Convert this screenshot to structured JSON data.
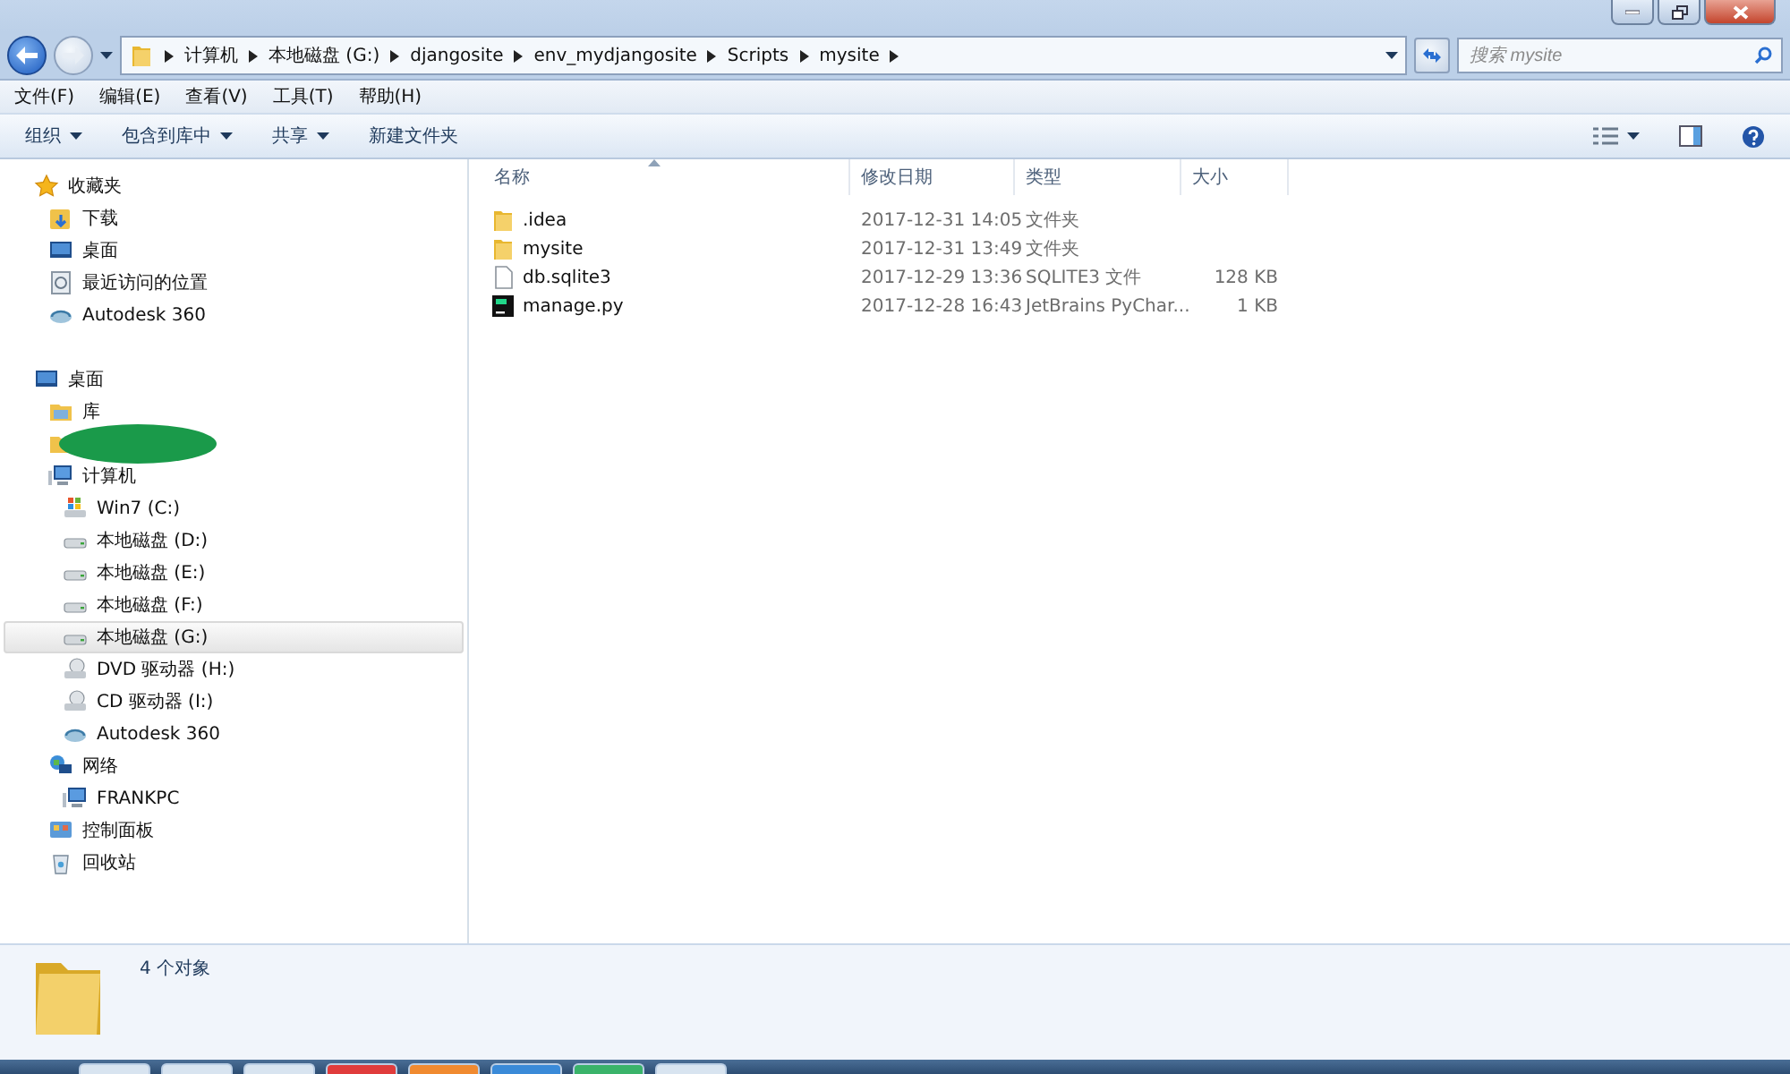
{
  "address": {
    "crumbs": [
      "计算机",
      "本地磁盘 (G:)",
      "djangosite",
      "env_mydjangosite",
      "Scripts",
      "mysite"
    ]
  },
  "search": {
    "placeholder": "搜索 mysite"
  },
  "menu": [
    "文件(F)",
    "编辑(E)",
    "查看(V)",
    "工具(T)",
    "帮助(H)"
  ],
  "toolbar": [
    {
      "label": "组织",
      "dropdown": true
    },
    {
      "label": "包含到库中",
      "dropdown": true
    },
    {
      "label": "共享",
      "dropdown": true
    },
    {
      "label": "新建文件夹",
      "dropdown": false
    }
  ],
  "sidebar": {
    "groups": [
      {
        "label": "收藏夹",
        "kind": "star",
        "selected": false,
        "children": [
          {
            "label": "下载",
            "kind": "download",
            "selected": false
          },
          {
            "label": "桌面",
            "kind": "desktop",
            "selected": false
          },
          {
            "label": "最近访问的位置",
            "kind": "recent",
            "selected": false
          },
          {
            "label": "Autodesk 360",
            "kind": "cloud",
            "selected": false
          }
        ]
      },
      {
        "label": "桌面",
        "kind": "desktop",
        "selected": false,
        "children": [
          {
            "label": "库",
            "kind": "library",
            "selected": false
          },
          {
            "kind": "redacted",
            "selected": false
          },
          {
            "label": "计算机",
            "kind": "computer",
            "selected": false,
            "children": [
              {
                "label": "Win7 (C:)",
                "kind": "windrive",
                "selected": false
              },
              {
                "label": "本地磁盘 (D:)",
                "kind": "drive",
                "selected": false
              },
              {
                "label": "本地磁盘 (E:)",
                "kind": "drive",
                "selected": false
              },
              {
                "label": "本地磁盘 (F:)",
                "kind": "drive",
                "selected": false
              },
              {
                "label": "本地磁盘 (G:)",
                "kind": "drive",
                "selected": true
              },
              {
                "label": "DVD 驱动器 (H:)",
                "kind": "optical",
                "selected": false
              },
              {
                "label": "CD 驱动器 (I:)",
                "kind": "optical",
                "selected": false
              },
              {
                "label": "Autodesk 360",
                "kind": "cloud",
                "selected": false
              }
            ]
          },
          {
            "label": "网络",
            "kind": "network",
            "selected": false,
            "children": [
              {
                "label": "FRANKPC",
                "kind": "computer",
                "selected": false
              }
            ]
          },
          {
            "label": "控制面板",
            "kind": "control",
            "selected": false
          },
          {
            "label": "回收站",
            "kind": "bin",
            "selected": false
          }
        ]
      }
    ]
  },
  "table": {
    "columns": [
      {
        "label": "名称",
        "sorted": true
      },
      {
        "label": "修改日期",
        "sorted": false
      },
      {
        "label": "类型",
        "sorted": false
      },
      {
        "label": "大小",
        "sorted": false
      }
    ],
    "rows": [
      {
        "kind": "folder",
        "name": ".idea",
        "date": "2017-12-31 14:05",
        "type": "文件夹"
      },
      {
        "kind": "folder",
        "name": "mysite",
        "date": "2017-12-31 13:49",
        "type": "文件夹"
      },
      {
        "kind": "file",
        "name": "db.sqlite3",
        "date": "2017-12-29 13:36",
        "type": "SQLITE3 文件",
        "size": "128 KB"
      },
      {
        "kind": "pycharm",
        "name": "manage.py",
        "date": "2017-12-28 16:43",
        "type": "JetBrains PyChar...",
        "size": "1 KB"
      }
    ]
  },
  "status_bar": {
    "count": "4 个对象"
  }
}
